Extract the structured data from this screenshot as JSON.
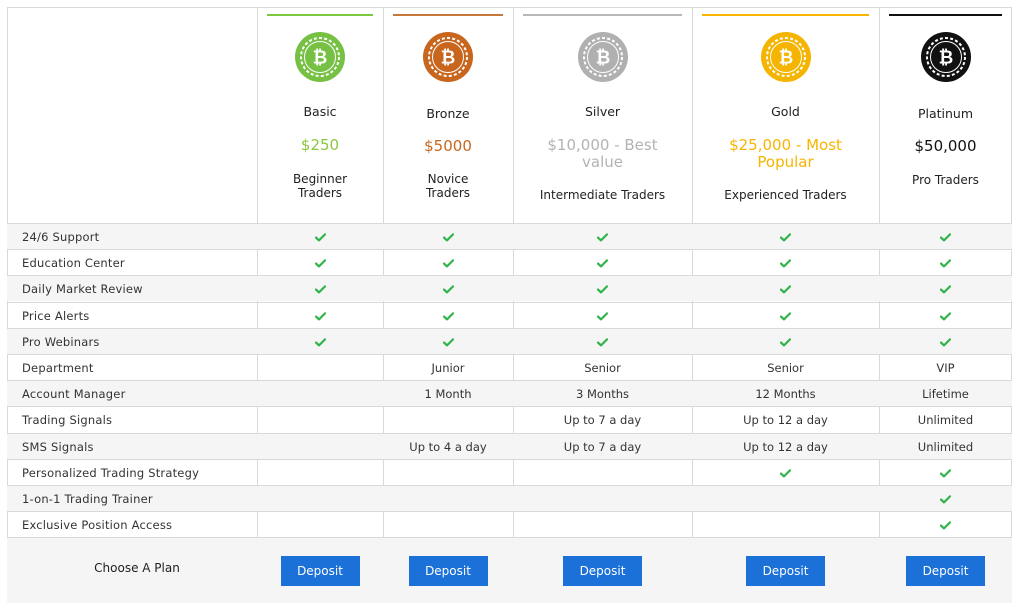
{
  "plans": [
    {
      "name": "Basic",
      "price": "$250",
      "audience": "Beginner\nTraders",
      "color": "#8cc63f",
      "coin_color": "#76c043",
      "bar_color": "#7ac943",
      "icon": "bitcoin-icon"
    },
    {
      "name": "Bronze",
      "price": "$5000",
      "audience": "Novice\nTraders",
      "color": "#c8661e",
      "coin_color": "#c8661e",
      "bar_color": "#c4783a",
      "icon": "bitcoin-icon"
    },
    {
      "name": "Silver",
      "price": "$10,000 - Best value",
      "audience": "Intermediate Traders",
      "color": "#b3b3b3",
      "coin_color": "#b0b0b0",
      "bar_color": "#b8b8b8",
      "icon": "bitcoin-icon"
    },
    {
      "name": "Gold",
      "price": "$25,000 - Most Popular",
      "audience": "Experienced Traders",
      "color": "#f7b500",
      "coin_color": "#f5b400",
      "bar_color": "#f7b500",
      "icon": "bitcoin-icon"
    },
    {
      "name": "Platinum",
      "price": "$50,000",
      "audience": "Pro Traders",
      "color": "#111111",
      "coin_color": "#111111",
      "bar_color": "#111111",
      "icon": "bitcoin-icon"
    }
  ],
  "features": [
    {
      "label": "24/6 Support",
      "values": [
        "check",
        "check",
        "check",
        "check",
        "check"
      ]
    },
    {
      "label": "Education Center",
      "values": [
        "check",
        "check",
        "check",
        "check",
        "check"
      ]
    },
    {
      "label": "Daily Market Review",
      "values": [
        "check",
        "check",
        "check",
        "check",
        "check"
      ]
    },
    {
      "label": "Price Alerts",
      "values": [
        "check",
        "check",
        "check",
        "check",
        "check"
      ]
    },
    {
      "label": "Pro Webinars",
      "values": [
        "check",
        "check",
        "check",
        "check",
        "check"
      ]
    },
    {
      "label": "Department",
      "values": [
        "",
        "Junior",
        "Senior",
        "Senior",
        "VIP"
      ]
    },
    {
      "label": "Account Manager",
      "values": [
        "",
        "1 Month",
        "3 Months",
        "12 Months",
        "Lifetime"
      ]
    },
    {
      "label": "Trading Signals",
      "values": [
        "",
        "",
        "Up to 7 a day",
        "Up to 12 a day",
        "Unlimited"
      ]
    },
    {
      "label": "SMS Signals",
      "values": [
        "",
        "Up to 4 a day",
        "Up to 7 a day",
        "Up to 12 a day",
        "Unlimited"
      ]
    },
    {
      "label": "Personalized Trading Strategy",
      "values": [
        "",
        "",
        "",
        "check",
        "check"
      ]
    },
    {
      "label": "1-on-1 Trading Trainer",
      "values": [
        "",
        "",
        "",
        "",
        "check"
      ]
    },
    {
      "label": "Exclusive Position Access",
      "values": [
        "",
        "",
        "",
        "",
        "check"
      ]
    }
  ],
  "footer": {
    "choose_label": "Choose A Plan",
    "deposit_label": "Deposit"
  },
  "icons": {
    "check": "check-icon"
  },
  "colors": {
    "check": "#2fb44a",
    "button": "#1c71d8",
    "border": "#d9d9d9",
    "alt_row": "#f5f5f5"
  }
}
